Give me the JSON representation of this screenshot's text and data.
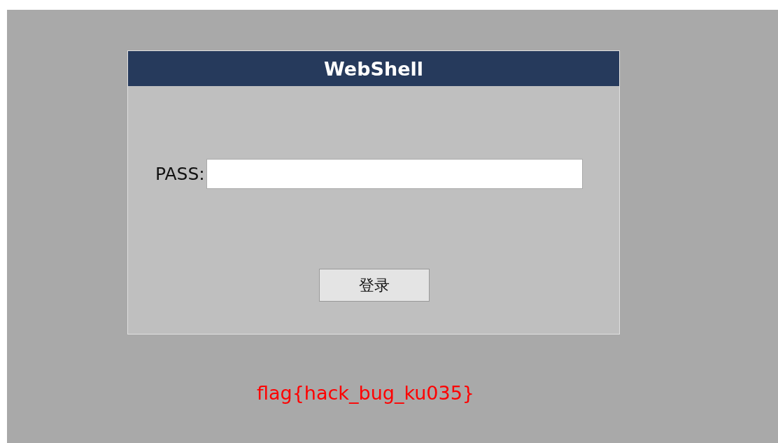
{
  "panel": {
    "title": "WebShell",
    "password_label": "PASS:",
    "login_button": "登录"
  },
  "flag": "flag{hack_bug_ku035}"
}
